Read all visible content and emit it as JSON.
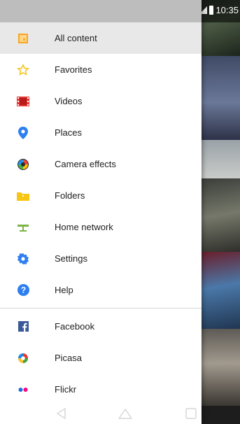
{
  "status_bar": {
    "time": "10:35"
  },
  "drawer": {
    "items": [
      {
        "label": "All content",
        "icon": "all-content-icon",
        "selected": true
      },
      {
        "label": "Favorites",
        "icon": "star-icon"
      },
      {
        "label": "Videos",
        "icon": "film-icon"
      },
      {
        "label": "Places",
        "icon": "map-pin-icon"
      },
      {
        "label": "Camera effects",
        "icon": "camera-effects-icon"
      },
      {
        "label": "Folders",
        "icon": "folder-icon"
      },
      {
        "label": "Home network",
        "icon": "home-network-icon"
      },
      {
        "label": "Settings",
        "icon": "gear-icon"
      },
      {
        "label": "Help",
        "icon": "help-icon"
      }
    ],
    "accounts": [
      {
        "label": "Facebook",
        "icon": "facebook-icon"
      },
      {
        "label": "Picasa",
        "icon": "picasa-icon"
      },
      {
        "label": "Flickr",
        "icon": "flickr-icon"
      }
    ]
  },
  "colors": {
    "accent_orange": "#f5a623",
    "favorites_yellow": "#f6c21c",
    "videos_red": "#e53935",
    "places_blue": "#2f7ff0",
    "settings_blue": "#2f7ff0",
    "facebook_blue": "#3b5998"
  },
  "nav": {
    "back": "back-icon",
    "home": "home-icon",
    "recent": "recent-apps-icon"
  }
}
